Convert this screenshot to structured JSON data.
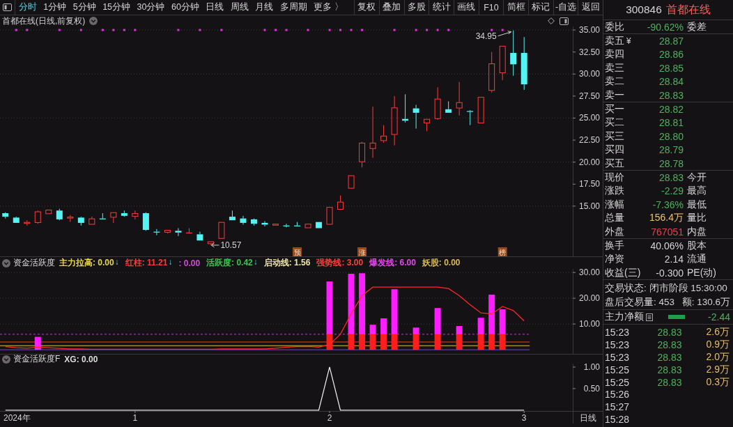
{
  "toolbar": {
    "periods": [
      {
        "label": "分时",
        "selected": true
      },
      {
        "label": "1分钟",
        "selected": false
      },
      {
        "label": "5分钟",
        "selected": false
      },
      {
        "label": "15分钟",
        "selected": false
      },
      {
        "label": "30分钟",
        "selected": false
      },
      {
        "label": "60分钟",
        "selected": false
      },
      {
        "label": "日线",
        "selected": false
      },
      {
        "label": "周线",
        "selected": false
      },
      {
        "label": "月线",
        "selected": false
      },
      {
        "label": "多周期",
        "selected": false
      },
      {
        "label": "更多 〉",
        "selected": false
      }
    ],
    "buttons": [
      "复权",
      "叠加",
      "多股",
      "统计",
      "画线",
      "F10",
      "简框",
      "标记",
      "-自选",
      "返回"
    ]
  },
  "chart": {
    "indicators": [
      {
        "name": "资金活跃度",
        "items": [
          {
            "text": "主力拉高: 0.00",
            "color": "#e8d64a",
            "arrow": "↓"
          },
          {
            "text": "红柱: 11.21",
            "color": "#ff3a3a",
            "arrow": "↓"
          },
          {
            "text": ": 0.00",
            "color": "#d646e0"
          },
          {
            "text": "活跃度: 0.42",
            "color": "#3ec24e",
            "arrow": "↓"
          },
          {
            "text": "启动线: 1.56",
            "color": "#efe6a6"
          },
          {
            "text": "强势线: 3.00",
            "color": "#ff4236"
          },
          {
            "text": "爆发线: 6.00",
            "color": "#e646ee"
          },
          {
            "text": "妖股: 0.00",
            "color": "#d9bb55"
          }
        ]
      },
      {
        "name": "资金活跃度F",
        "items": [
          {
            "text": "XG: 0.00",
            "color": "#dcdcdc"
          }
        ]
      }
    ],
    "year_label": "2024年",
    "corner_label": "日线",
    "chart_data": [
      {
        "type": "candlestick",
        "title": "首都在线(日线,前复权)",
        "grid": true,
        "ylim": [
          9.3,
          35.4
        ],
        "yticks": [
          {
            "value": 15,
            "label": "15.00"
          },
          {
            "value": 17.5,
            "label": "17.50"
          },
          {
            "value": 20,
            "label": "20.00"
          },
          {
            "value": 22.5,
            "label": "22.50"
          },
          {
            "value": 25,
            "label": "25.00"
          },
          {
            "value": 27.5,
            "label": "27.50"
          },
          {
            "value": 30,
            "label": "30.00"
          },
          {
            "value": 32.5,
            "label": "32.50"
          },
          {
            "value": 35,
            "label": "35.00"
          }
        ],
        "categories": [
          null,
          null,
          null,
          null,
          null,
          null,
          null,
          null,
          null,
          null,
          null,
          null,
          null,
          null,
          null,
          null,
          null,
          null,
          null,
          null,
          null,
          null,
          null,
          null,
          null,
          null,
          null,
          null,
          null,
          null,
          null,
          null,
          null,
          null,
          null,
          null,
          null,
          null,
          null,
          null,
          null,
          null,
          null,
          null,
          null,
          null,
          null,
          null,
          null,
          null,
          null,
          null,
          null
        ],
        "ohlc": [
          [
            14.2,
            14.3,
            13.6,
            13.8
          ],
          [
            13.7,
            13.8,
            13.1,
            13.1
          ],
          [
            13.0,
            13.4,
            12.8,
            13.2
          ],
          [
            13.1,
            14.5,
            13.0,
            14.4
          ],
          [
            14.1,
            14.6,
            14.1,
            14.6
          ],
          [
            14.5,
            14.7,
            13.4,
            13.5
          ],
          [
            13.6,
            14.0,
            13.2,
            13.8
          ],
          [
            13.7,
            13.8,
            12.8,
            13.1
          ],
          [
            12.9,
            13.8,
            12.9,
            13.6
          ],
          [
            13.6,
            14.2,
            13.5,
            13.5
          ],
          [
            13.7,
            14.3,
            13.1,
            14.3
          ],
          [
            14.2,
            14.5,
            13.8,
            13.9
          ],
          [
            13.8,
            14.5,
            13.5,
            14.2
          ],
          [
            14.2,
            14.3,
            12.2,
            12.3
          ],
          [
            12.1,
            12.4,
            11.7,
            12.0
          ],
          [
            12.0,
            12.3,
            11.9,
            12.3
          ],
          [
            12.2,
            12.5,
            11.6,
            12.0
          ],
          [
            11.9,
            12.5,
            11.9,
            12.0
          ],
          [
            11.8,
            12.1,
            11.1,
            11.1
          ],
          [
            10.7,
            11.0,
            10.57,
            11.0
          ],
          [
            11.3,
            13.2,
            11.3,
            13.2
          ],
          [
            13.8,
            14.5,
            13.4,
            13.4
          ],
          [
            13.6,
            13.9,
            12.9,
            13.1
          ],
          [
            13.5,
            13.6,
            12.8,
            13.0
          ],
          [
            13.1,
            13.3,
            12.7,
            12.9
          ],
          [
            12.8,
            13.0,
            12.8,
            13.0
          ],
          [
            12.8,
            13.0,
            12.6,
            12.7
          ],
          [
            12.8,
            13.2,
            12.7,
            12.7
          ],
          [
            12.5,
            13.0,
            12.5,
            13.0
          ],
          [
            13.2,
            13.2,
            12.5,
            12.5
          ],
          [
            12.9,
            14.9,
            12.9,
            14.9
          ],
          [
            14.6,
            16.2,
            14.6,
            15.5
          ],
          [
            17.0,
            18.5,
            17.0,
            18.5
          ],
          [
            20.0,
            22.3,
            19.4,
            22.2
          ],
          [
            21.5,
            26.3,
            20.5,
            22.2
          ],
          [
            22.4,
            24.2,
            22.2,
            23.0
          ],
          [
            23.1,
            27.5,
            21.9,
            26.2
          ],
          [
            24.9,
            27.7,
            24.5,
            24.7
          ],
          [
            26.1,
            26.5,
            23.8,
            25.6
          ],
          [
            24.4,
            24.9,
            23.5,
            24.9
          ],
          [
            24.9,
            28.5,
            24.8,
            27.2
          ],
          [
            26.0,
            26.9,
            25.6,
            25.6
          ],
          [
            26.1,
            29.1,
            25.3,
            26.8
          ],
          [
            25.8,
            25.9,
            24.2,
            25.7
          ],
          [
            24.4,
            27.4,
            24.4,
            27.4
          ],
          [
            28.1,
            32.5,
            27.9,
            31.2
          ],
          [
            30.1,
            33.2,
            29.3,
            33.2
          ],
          [
            32.4,
            34.95,
            29.8,
            31.1
          ],
          [
            32.4,
            34.2,
            28.2,
            28.83
          ],
          null,
          null,
          null,
          null
        ],
        "series": [
          {
            "type": "scatter",
            "color": "#e030e0",
            "values": [
              null,
              35,
              35,
              null,
              null,
              35,
              null,
              35,
              null,
              35,
              35,
              35,
              35,
              null,
              null,
              null,
              35,
              null,
              35,
              null,
              35,
              null,
              null,
              null,
              35,
              35,
              35,
              null,
              35,
              null,
              35,
              35,
              35,
              35,
              null,
              null,
              35,
              null,
              35,
              35,
              35,
              35,
              null,
              null,
              null,
              35,
              35,
              null,
              null,
              null,
              null,
              null,
              null
            ]
          }
        ],
        "annotations": [
          "34.95",
          "10.57",
          "预",
          "涨",
          "榜"
        ]
      },
      {
        "type": "bar",
        "stacked": true,
        "grid": true,
        "ylim": [
          -1.6,
          31.4
        ],
        "yticks": [
          {
            "value": 10,
            "label": "10.00"
          },
          {
            "value": 20,
            "label": "20.00"
          },
          {
            "value": 30,
            "label": "30.00"
          }
        ],
        "categories": [
          null,
          null,
          null,
          null,
          null,
          null,
          null,
          null,
          null,
          null,
          null,
          null,
          null,
          null,
          null,
          null,
          null,
          null,
          null,
          null,
          null,
          null,
          null,
          null,
          null,
          null,
          null,
          null,
          null,
          null,
          null,
          null,
          null,
          null,
          null,
          null,
          null,
          null,
          null,
          null,
          null,
          null,
          null,
          null,
          null,
          null,
          null,
          null,
          null,
          null,
          null,
          null,
          null
        ],
        "ref_lines": [
          {
            "axis": "y",
            "value": 6,
            "color": "#c43cc8",
            "line_style": "dashed"
          },
          {
            "axis": "y",
            "value": 3,
            "color": "#e8461e",
            "line_style": "solid"
          },
          {
            "axis": "y",
            "value": 1.56,
            "color": "#d8c23c",
            "line_style": "solid"
          },
          {
            "axis": "y",
            "value": 0,
            "color": "#7a4ac8",
            "line_style": "solid"
          }
        ],
        "series": [
          {
            "color": "#ff1e1e",
            "values": [
              null,
              null,
              null,
              null,
              null,
              null,
              null,
              null,
              null,
              null,
              null,
              null,
              null,
              null,
              null,
              null,
              null,
              null,
              null,
              null,
              null,
              null,
              null,
              null,
              null,
              null,
              null,
              null,
              null,
              null,
              6,
              null,
              6,
              6,
              6,
              6,
              6,
              null,
              6,
              null,
              6,
              null,
              6,
              null,
              6,
              6,
              6,
              null,
              null,
              null,
              null,
              null,
              null
            ]
          },
          {
            "color": "#ff1eff",
            "values": [
              null,
              null,
              null,
              5,
              null,
              null,
              null,
              null,
              null,
              null,
              null,
              null,
              null,
              null,
              null,
              null,
              null,
              null,
              null,
              null,
              null,
              null,
              null,
              null,
              null,
              null,
              null,
              null,
              null,
              null,
              20.5,
              null,
              23.5,
              23.7,
              3.7,
              6.2,
              17.5,
              null,
              2.6,
              null,
              10.2,
              null,
              3.2,
              null,
              6.4,
              15.4,
              9.7,
              null,
              null,
              null,
              null,
              null,
              null
            ]
          },
          {
            "type": "line",
            "color": "#ff2828",
            "values": [
              1.2,
              0.8,
              0.6,
              1.0,
              0.8,
              0.5,
              0.3,
              0.3,
              0.2,
              0.2,
              0.2,
              0.2,
              0.2,
              0.2,
              0.2,
              0.2,
              0.2,
              0.2,
              0.2,
              0.2,
              0.3,
              0.3,
              0.3,
              0.3,
              0.3,
              0.6,
              1.0,
              1.2,
              1.3,
              1.0,
              2.0,
              6.0,
              14.0,
              21.0,
              24.3,
              24.3,
              24.3,
              24.3,
              24.3,
              24.3,
              24.3,
              23.8,
              21.0,
              17.5,
              14.3,
              13.9,
              16.8,
              15.2,
              11.2,
              null,
              null,
              null,
              null
            ]
          }
        ]
      },
      {
        "type": "line",
        "color": "#e8e8e8",
        "ylim": [
          -0.02,
          1.08
        ],
        "yticks": [
          {
            "value": 0.5,
            "label": "0.50"
          },
          {
            "value": 1,
            "label": "1.00"
          }
        ],
        "categories": [
          null,
          null,
          null,
          null,
          null,
          null,
          null,
          null,
          null,
          null,
          null,
          null,
          "1",
          null,
          null,
          null,
          null,
          null,
          null,
          null,
          null,
          null,
          null,
          null,
          null,
          null,
          null,
          null,
          null,
          null,
          "2",
          null,
          null,
          null,
          null,
          null,
          null,
          null,
          null,
          null,
          null,
          null,
          null,
          null,
          null,
          null,
          null,
          null,
          "3",
          null,
          null,
          null,
          null
        ],
        "values": [
          0,
          0,
          0,
          0,
          0,
          0,
          0,
          0,
          0,
          0,
          0,
          0,
          0,
          0,
          0,
          0,
          0,
          0,
          0,
          0,
          0,
          0,
          0,
          0,
          0,
          0,
          0,
          0,
          0,
          0,
          1,
          0,
          0,
          0,
          0,
          0,
          0,
          0,
          0,
          0,
          0,
          0,
          0,
          0,
          0,
          0,
          0,
          0,
          0,
          null,
          null,
          null,
          null
        ]
      }
    ]
  },
  "quote": {
    "code": "300846",
    "name": "首都在线",
    "ratio": {
      "label": "委比",
      "value": "-90.62%",
      "label2": "委差"
    },
    "asks": [
      {
        "label": "卖五",
        "currency": "¥",
        "price": "28.87"
      },
      {
        "label": "卖四",
        "price": "28.86"
      },
      {
        "label": "卖三",
        "price": "28.85"
      },
      {
        "label": "卖二",
        "price": "28.84"
      },
      {
        "label": "卖一",
        "price": "28.83"
      }
    ],
    "bids": [
      {
        "label": "买一",
        "price": "28.82"
      },
      {
        "label": "买二",
        "price": "28.81"
      },
      {
        "label": "买三",
        "price": "28.80"
      },
      {
        "label": "买四",
        "price": "28.79"
      },
      {
        "label": "买五",
        "price": "28.78"
      }
    ],
    "stats": [
      {
        "label": "现价",
        "value": "28.83",
        "color": "#4db35c",
        "label2": "今开"
      },
      {
        "label": "涨跌",
        "value": "-2.29",
        "color": "#4db35c",
        "label2": "最高"
      },
      {
        "label": "涨幅",
        "value": "-7.36%",
        "color": "#4db35c",
        "label2": "最低"
      },
      {
        "label": "总量",
        "value": "156.4万",
        "color": "#eec373",
        "label2": "量比"
      },
      {
        "label": "外盘",
        "value": "767051",
        "color": "#e8404e",
        "label2": "内盘"
      }
    ],
    "fundamentals": [
      {
        "label": "换手",
        "value": "40.06%",
        "label2": "股本"
      },
      {
        "label": "净资",
        "value": "2.14",
        "label2": "流通"
      },
      {
        "label": "收益(三)",
        "value": "-0.300",
        "label2": "PE(动)"
      }
    ],
    "trading_status": "交易状态: 闭市阶段 15:30:00",
    "after_hours": [
      "盘后交易量: 453",
      "额: 130.6万"
    ],
    "net_flow": {
      "label": "主力净额",
      "value": "-2.44"
    },
    "ticks": [
      {
        "time": "15:23",
        "price": "28.83",
        "volume": "2.6万"
      },
      {
        "time": "15:23",
        "price": "28.83",
        "volume": "0.9万"
      },
      {
        "time": "15:23",
        "price": "28.83",
        "volume": "2.0万"
      },
      {
        "time": "15:25",
        "price": "28.83",
        "volume": "2.9万"
      },
      {
        "time": "15:25",
        "price": "28.83",
        "volume": "0.3万"
      },
      {
        "time": "15:26"
      },
      {
        "time": "15:27"
      },
      {
        "time": "15:28"
      }
    ]
  }
}
